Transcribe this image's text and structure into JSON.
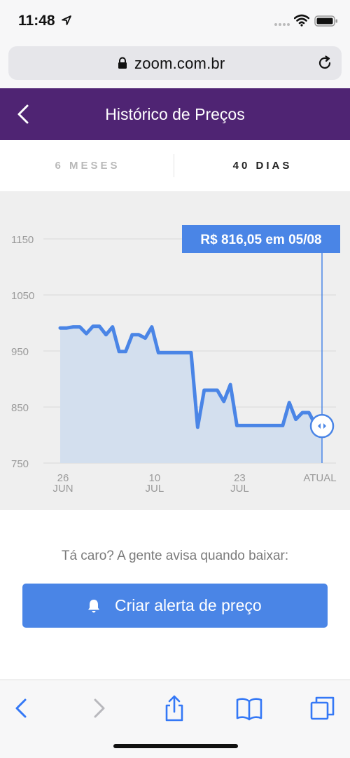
{
  "status": {
    "time": "11:48"
  },
  "browser": {
    "url": "zoom.com.br"
  },
  "header": {
    "title": "Histórico de Preços"
  },
  "tabs": [
    {
      "label": "6 MESES",
      "active": false
    },
    {
      "label": "40 DIAS",
      "active": true
    }
  ],
  "chart_data": {
    "type": "area",
    "title": "",
    "xlabel": "",
    "ylabel": "",
    "ylim": [
      750,
      1150
    ],
    "yticks": [
      750,
      850,
      950,
      1050,
      1150
    ],
    "x_ticks": [
      {
        "day": "26",
        "month": "JUN",
        "x": 0
      },
      {
        "day": "10",
        "month": "JUL",
        "x": 14
      },
      {
        "day": "23",
        "month": "JUL",
        "x": 27
      },
      {
        "day": "ATUAL",
        "month": "",
        "x": 40
      }
    ],
    "series": [
      {
        "color": "#4a85e6",
        "points": [
          [
            0,
            991
          ],
          [
            1,
            991
          ],
          [
            2,
            993
          ],
          [
            3,
            993
          ],
          [
            4,
            981
          ],
          [
            5,
            994
          ],
          [
            6,
            994
          ],
          [
            7,
            979
          ],
          [
            8,
            993
          ],
          [
            9,
            949
          ],
          [
            10,
            949
          ],
          [
            11,
            979
          ],
          [
            12,
            979
          ],
          [
            13,
            973
          ],
          [
            14,
            993
          ],
          [
            15,
            947
          ],
          [
            16,
            947
          ],
          [
            17,
            947
          ],
          [
            18,
            947
          ],
          [
            19,
            947
          ],
          [
            20,
            947
          ],
          [
            21,
            814
          ],
          [
            22,
            880
          ],
          [
            23,
            880
          ],
          [
            24,
            880
          ],
          [
            25,
            860
          ],
          [
            26,
            890
          ],
          [
            27,
            817
          ],
          [
            28,
            817
          ],
          [
            29,
            817
          ],
          [
            30,
            817
          ],
          [
            31,
            817
          ],
          [
            32,
            817
          ],
          [
            33,
            817
          ],
          [
            34,
            817
          ],
          [
            35,
            858
          ],
          [
            36,
            828
          ],
          [
            37,
            840
          ],
          [
            38,
            840
          ],
          [
            39,
            818
          ],
          [
            40,
            816.05
          ]
        ]
      }
    ],
    "tooltip": {
      "label": "R$ 816,05 em 05/08",
      "x": 40,
      "y": 816.05
    },
    "grid": true
  },
  "prompt_text": "Tá caro? A gente avisa quando baixar:",
  "cta": {
    "label": "Criar alerta de preço",
    "icon": "bell-icon"
  },
  "colors": {
    "header": "#4f2473",
    "accent": "#4a85e6",
    "fill": "#d3dfee"
  }
}
